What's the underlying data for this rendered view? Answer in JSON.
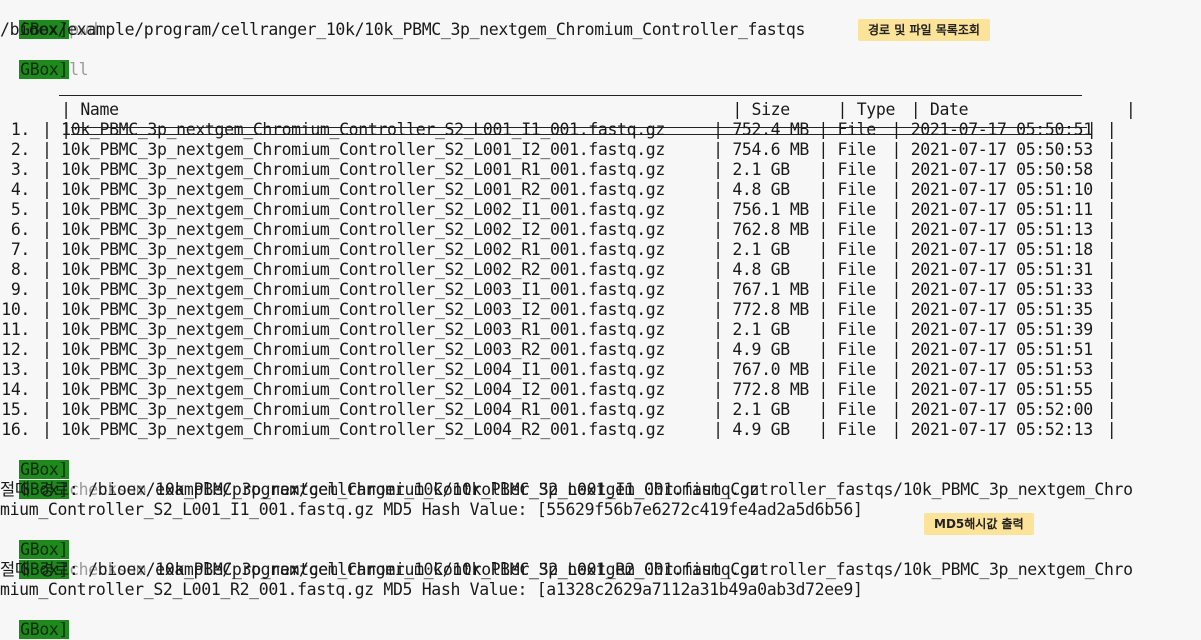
{
  "terminal": {
    "prompt": "GBox]",
    "cmd_pwd": "pwd",
    "pwd_output": "/bioex/example/program/cellranger_10k/10k_PBMC_3p_nextgem_Chromium_Controller_fastqs",
    "cmd_ll": "ll",
    "table": {
      "top_rule": " ____________________________________________________________________________________________________________________________",
      "header_name": "Name",
      "header_size": "Size",
      "header_type": "Type",
      "header_date": "Date",
      "separator": "|==============================================================================================================|",
      "rows": [
        {
          "idx": "1.",
          "name": "10k_PBMC_3p_nextgem_Chromium_Controller_S2_L001_I1_001.fastq.gz",
          "size": "752.4 MB",
          "type": "File",
          "date": "2021-07-17 05:50:51"
        },
        {
          "idx": "2.",
          "name": "10k_PBMC_3p_nextgem_Chromium_Controller_S2_L001_I2_001.fastq.gz",
          "size": "754.6 MB",
          "type": "File",
          "date": "2021-07-17 05:50:53"
        },
        {
          "idx": "3.",
          "name": "10k_PBMC_3p_nextgem_Chromium_Controller_S2_L001_R1_001.fastq.gz",
          "size": "2.1 GB",
          "type": "File",
          "date": "2021-07-17 05:50:58"
        },
        {
          "idx": "4.",
          "name": "10k_PBMC_3p_nextgem_Chromium_Controller_S2_L001_R2_001.fastq.gz",
          "size": "4.8 GB",
          "type": "File",
          "date": "2021-07-17 05:51:10"
        },
        {
          "idx": "5.",
          "name": "10k_PBMC_3p_nextgem_Chromium_Controller_S2_L002_I1_001.fastq.gz",
          "size": "756.1 MB",
          "type": "File",
          "date": "2021-07-17 05:51:11"
        },
        {
          "idx": "6.",
          "name": "10k_PBMC_3p_nextgem_Chromium_Controller_S2_L002_I2_001.fastq.gz",
          "size": "762.8 MB",
          "type": "File",
          "date": "2021-07-17 05:51:13"
        },
        {
          "idx": "7.",
          "name": "10k_PBMC_3p_nextgem_Chromium_Controller_S2_L002_R1_001.fastq.gz",
          "size": "2.1 GB",
          "type": "File",
          "date": "2021-07-17 05:51:18"
        },
        {
          "idx": "8.",
          "name": "10k_PBMC_3p_nextgem_Chromium_Controller_S2_L002_R2_001.fastq.gz",
          "size": "4.8 GB",
          "type": "File",
          "date": "2021-07-17 05:51:31"
        },
        {
          "idx": "9.",
          "name": "10k_PBMC_3p_nextgem_Chromium_Controller_S2_L003_I1_001.fastq.gz",
          "size": "767.1 MB",
          "type": "File",
          "date": "2021-07-17 05:51:33"
        },
        {
          "idx": "10.",
          "name": "10k_PBMC_3p_nextgem_Chromium_Controller_S2_L003_I2_001.fastq.gz",
          "size": "772.8 MB",
          "type": "File",
          "date": "2021-07-17 05:51:35"
        },
        {
          "idx": "11.",
          "name": "10k_PBMC_3p_nextgem_Chromium_Controller_S2_L003_R1_001.fastq.gz",
          "size": "2.1 GB",
          "type": "File",
          "date": "2021-07-17 05:51:39"
        },
        {
          "idx": "12.",
          "name": "10k_PBMC_3p_nextgem_Chromium_Controller_S2_L003_R2_001.fastq.gz",
          "size": "4.9 GB",
          "type": "File",
          "date": "2021-07-17 05:51:51"
        },
        {
          "idx": "13.",
          "name": "10k_PBMC_3p_nextgem_Chromium_Controller_S2_L004_I1_001.fastq.gz",
          "size": "767.0 MB",
          "type": "File",
          "date": "2021-07-17 05:51:53"
        },
        {
          "idx": "14.",
          "name": "10k_PBMC_3p_nextgem_Chromium_Controller_S2_L004_I2_001.fastq.gz",
          "size": "772.8 MB",
          "type": "File",
          "date": "2021-07-17 05:51:55"
        },
        {
          "idx": "15.",
          "name": "10k_PBMC_3p_nextgem_Chromium_Controller_S2_L004_R1_001.fastq.gz",
          "size": "2.1 GB",
          "type": "File",
          "date": "2021-07-17 05:52:00"
        },
        {
          "idx": "16.",
          "name": "10k_PBMC_3p_nextgem_Chromium_Controller_S2_L004_R2_001.fastq.gz",
          "size": "4.9 GB",
          "type": "File",
          "date": "2021-07-17 05:52:13"
        }
      ]
    },
    "checksum1": {
      "cmd": "checksum",
      "arg": " 10k_PBMC_3p_nextgem_Chromium_Controller_S2_L001_I1_001.fastq.gz",
      "out_line1": "절대 경로: /bioex/example/program/cellranger_10k/10k_PBMC_3p_nextgem_Chromium_Controller_fastqs/10k_PBMC_3p_nextgem_Chro",
      "out_line2": "mium_Controller_S2_L001_I1_001.fastq.gz MD5 Hash Value: [55629f56b7e6272c419fe4ad2a5d6b56]"
    },
    "checksum2": {
      "cmd": "checksum",
      "arg": " 10k_PBMC_3p_nextgem_Chromium_Controller_S2_L001_R2_001.fastq.gz",
      "out_line1": "절대 경로: /bioex/example/program/cellranger_10k/10k_PBMC_3p_nextgem_Chromium_Controller_fastqs/10k_PBMC_3p_nextgem_Chro",
      "out_line2": "mium_Controller_S2_L001_R2_001.fastq.gz MD5 Hash Value: [a1328c2629a7112a31b49a0ab3d72ee9]"
    }
  },
  "annotations": {
    "badge_path": "경로 및 파일 목록조회",
    "badge_md5": "MD5해시값 출력"
  },
  "colors": {
    "prompt_bg": "#1e8a1e",
    "badge_bg": "#fbe39a",
    "background": "#f7f7f7"
  }
}
